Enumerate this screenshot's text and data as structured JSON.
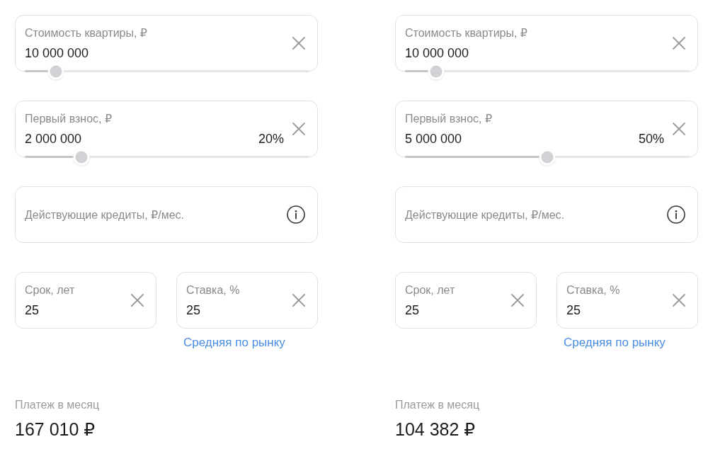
{
  "panels": [
    {
      "fields": [
        {
          "kind": "slider",
          "label": "Стоимость квартиры, ₽",
          "value": "10 000 000",
          "level": 0.11
        },
        {
          "kind": "slider",
          "label": "Первый взнос, ₽",
          "value": "2 000 000",
          "percent": "20%",
          "level": 0.2
        },
        {
          "kind": "info",
          "placeholder": "Действующие кредиты, ₽/мес."
        }
      ],
      "term": {
        "label": "Срок, лет",
        "value": "25"
      },
      "rate": {
        "label": "Ставка, %",
        "value": "25",
        "link": "Средняя по рынку"
      },
      "payment": {
        "label": "Платеж в месяц",
        "amount": "167 010 ₽"
      }
    },
    {
      "fields": [
        {
          "kind": "slider",
          "label": "Стоимость квартиры, ₽",
          "value": "10 000 000",
          "level": 0.11
        },
        {
          "kind": "slider",
          "label": "Первый взнос, ₽",
          "value": "5 000 000",
          "percent": "50%",
          "level": 0.5
        },
        {
          "kind": "info",
          "placeholder": "Действующие кредиты, ₽/мес."
        }
      ],
      "term": {
        "label": "Срок, лет",
        "value": "25"
      },
      "rate": {
        "label": "Ставка, %",
        "value": "25",
        "link": "Средняя по рынку"
      },
      "payment": {
        "label": "Платеж в месяц",
        "amount": "104 382 ₽"
      }
    }
  ]
}
